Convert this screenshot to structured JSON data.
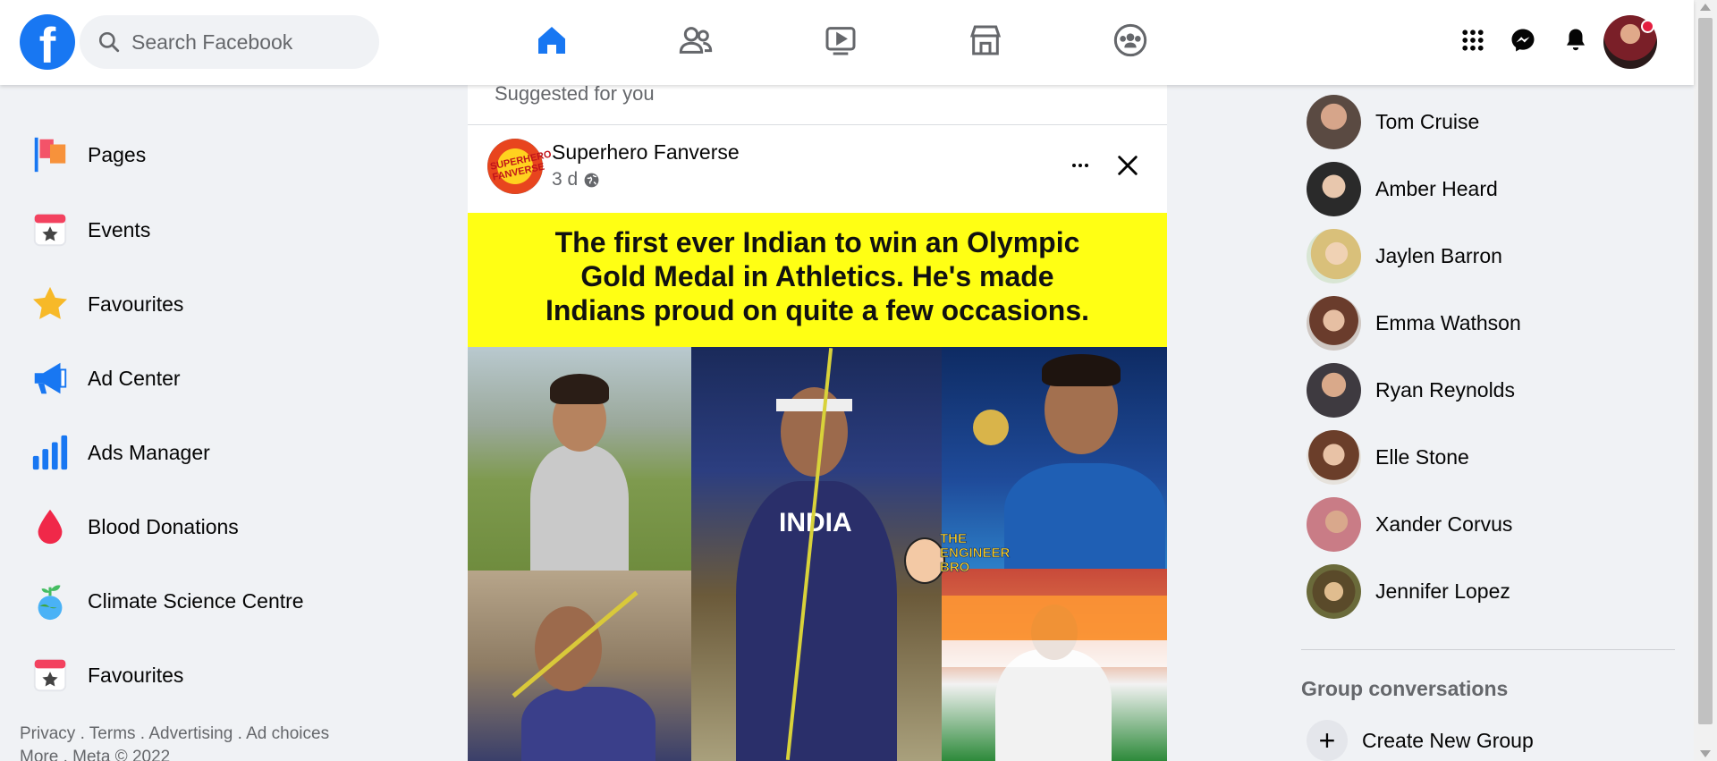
{
  "colors": {
    "brand": "#1877f2",
    "background": "#f0f2f5",
    "banner": "#ffff14",
    "notification": "#e41e3f"
  },
  "header": {
    "logo_icon": "facebook-logo",
    "search": {
      "placeholder": "Search Facebook"
    },
    "nav": [
      "home-icon",
      "friends-icon",
      "watch-icon",
      "marketplace-icon",
      "groups-icon"
    ],
    "right": [
      "menu-grid-icon",
      "messenger-icon",
      "notifications-icon",
      "profile-avatar"
    ]
  },
  "sidebar": {
    "items": [
      {
        "label": "Pages",
        "icon": "pages-flag-icon"
      },
      {
        "label": "Events",
        "icon": "events-calendar-icon"
      },
      {
        "label": "Favourites",
        "icon": "star-icon"
      },
      {
        "label": "Ad Center",
        "icon": "megaphone-icon"
      },
      {
        "label": "Ads Manager",
        "icon": "bar-chart-icon"
      },
      {
        "label": "Blood Donations",
        "icon": "blood-drop-icon"
      },
      {
        "label": "Climate Science Centre",
        "icon": "globe-plant-icon"
      },
      {
        "label": "Favourites",
        "icon": "calendar-star-icon"
      }
    ],
    "footer": {
      "privacy": "Privacy",
      "terms": "Terms",
      "advertising": "Advertising",
      "ad_choices": "Ad choices",
      "more": "More",
      "meta": "Meta © 2022",
      "sep": " . "
    }
  },
  "feed": {
    "suggested_label": "Suggested for you",
    "post": {
      "page_name": "Superhero Fanverse",
      "avatar_text": "SUPERHERO FANVERSE",
      "time": "3 d",
      "privacy_icon": "globe-icon",
      "banner_lines": [
        "The first ever Indian to win an Olympic",
        "Gold Medal in Athletics. He's made",
        "Indians proud on quite a few occasions."
      ],
      "jersey_text": "INDIA",
      "watermark": "THE ENGINEER BRO"
    }
  },
  "contacts": [
    {
      "name": "Tom Cruise",
      "color": "#5a4a42"
    },
    {
      "name": "Amber Heard",
      "color": "#2a2a2a"
    },
    {
      "name": "Jaylen Barron",
      "color": "#d9c8a3"
    },
    {
      "name": "Emma Wathson",
      "color": "#8a5a4a"
    },
    {
      "name": "Ryan Reynolds",
      "color": "#3e3a40"
    },
    {
      "name": "Elle Stone",
      "color": "#a67358"
    },
    {
      "name": "Xander Corvus",
      "color": "#c97c86"
    },
    {
      "name": "Jennifer Lopez",
      "color": "#6a6a3a"
    }
  ],
  "group_conversations": {
    "title": "Group conversations",
    "create_label": "Create New Group"
  }
}
